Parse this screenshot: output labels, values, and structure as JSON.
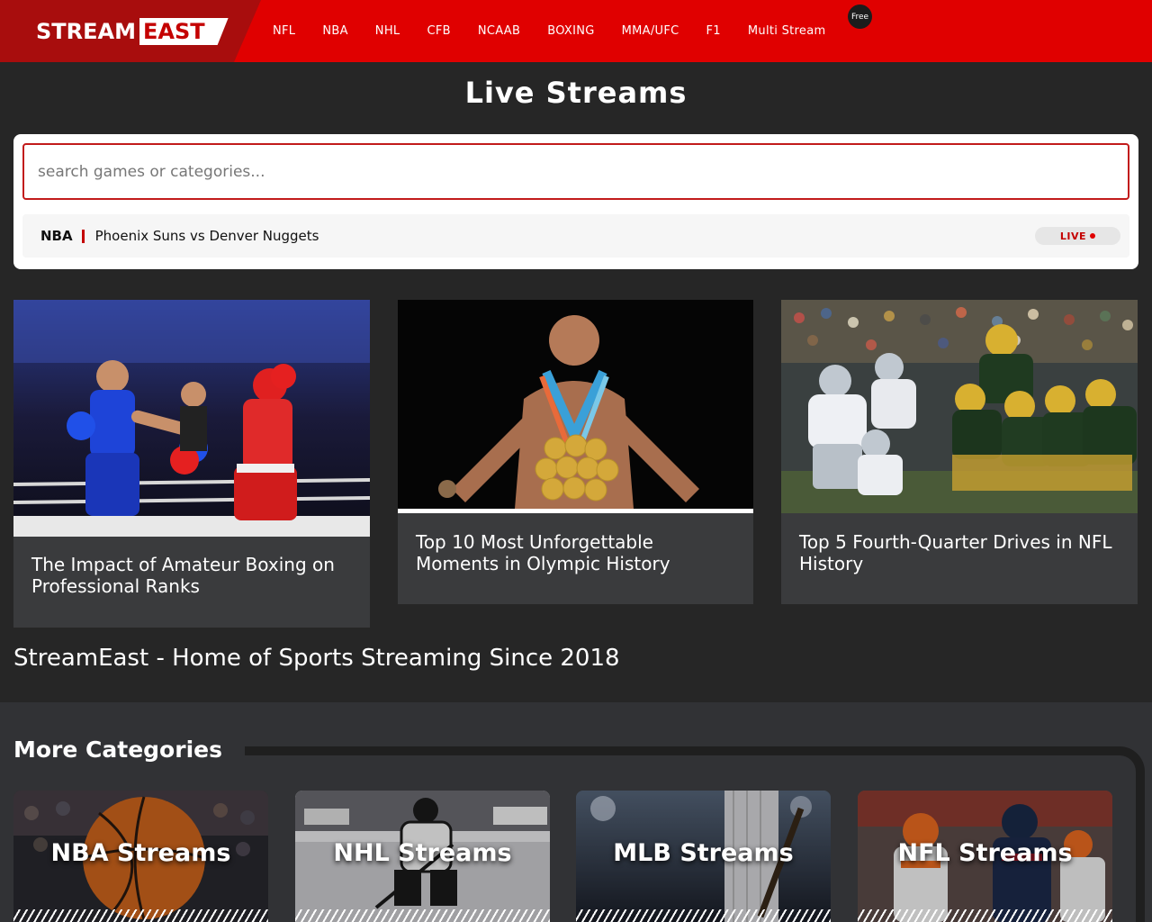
{
  "header": {
    "logo_part1": "STREAM",
    "logo_part2": "EAST",
    "nav": [
      "NFL",
      "NBA",
      "NHL",
      "CFB",
      "NCAAB",
      "BOXING",
      "MMA/UFC",
      "F1",
      "Multi Stream"
    ],
    "free_badge": "Free"
  },
  "page_title": "Live Streams",
  "search": {
    "placeholder": "search games or categories..."
  },
  "live_stream": {
    "league": "NBA",
    "title": "Phoenix Suns vs Denver Nuggets",
    "status": "LIVE"
  },
  "articles": [
    {
      "title": "The Impact of Amateur Boxing on Professional Ranks",
      "image": "boxing-photo"
    },
    {
      "title": "Top 10 Most Unforgettable Moments in Olympic History",
      "image": "olympic-swimmer-photo"
    },
    {
      "title": "Top 5 Fourth-Quarter Drives in NFL History",
      "image": "football-photo"
    }
  ],
  "tagline": "StreamEast - Home of Sports Streaming Since 2018",
  "more_categories": {
    "title": "More Categories",
    "items": [
      {
        "label": "NBA Streams"
      },
      {
        "label": "NHL Streams"
      },
      {
        "label": "MLB Streams"
      },
      {
        "label": "NFL Streams"
      }
    ]
  },
  "colors": {
    "brand_red": "#e00000",
    "logo_bg": "#a80d0d",
    "page_bg": "#262626",
    "card_bg": "#3a3b3d"
  }
}
